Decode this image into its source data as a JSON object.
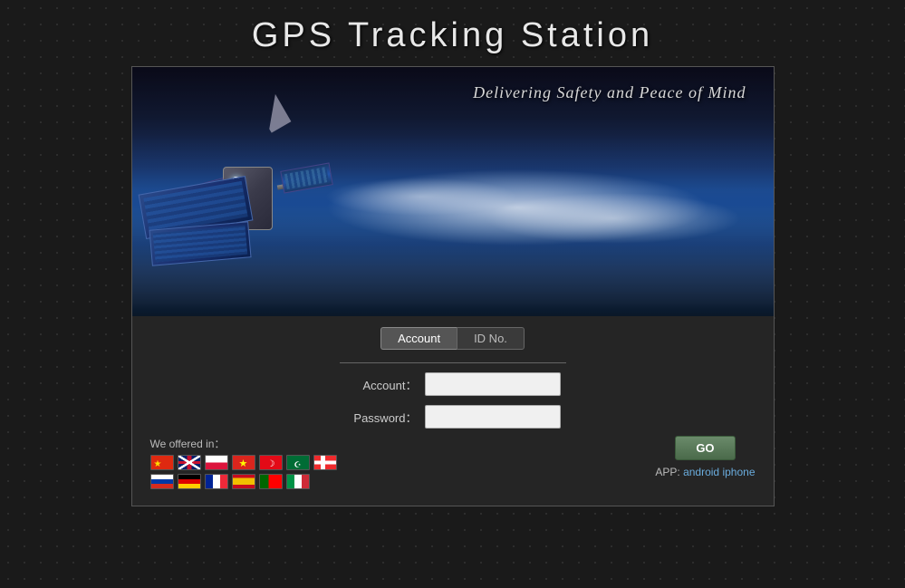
{
  "page": {
    "title": "GPS Tracking Station",
    "tagline": "Delivering Safety and Peace of Mind"
  },
  "tabs": [
    {
      "id": "account",
      "label": "Account",
      "active": true
    },
    {
      "id": "idno",
      "label": "ID No.",
      "active": false
    }
  ],
  "form": {
    "account_label": "Account：",
    "account_placeholder": "",
    "password_label": "Password：",
    "password_placeholder": ""
  },
  "buttons": {
    "go_label": "GO",
    "app_prefix": "APP:",
    "android_label": "android",
    "iphone_label": "iphone"
  },
  "languages": {
    "label": "We offered in：",
    "flags": [
      {
        "id": "cn",
        "name": "Chinese",
        "class": "flag-cn"
      },
      {
        "id": "gb",
        "name": "English",
        "class": "flag-gb"
      },
      {
        "id": "pl",
        "name": "Polish",
        "class": "flag-pl"
      },
      {
        "id": "vn",
        "name": "Vietnamese",
        "class": "flag-vn"
      },
      {
        "id": "tr",
        "name": "Turkish",
        "class": "flag-tr"
      },
      {
        "id": "sa",
        "name": "Arabic",
        "class": "flag-sa"
      },
      {
        "id": "no",
        "name": "Norwegian",
        "class": "flag-no"
      },
      {
        "id": "ru",
        "name": "Russian",
        "class": "flag-ru"
      },
      {
        "id": "de",
        "name": "German",
        "class": "flag-de"
      },
      {
        "id": "fr",
        "name": "French",
        "class": "flag-fr"
      },
      {
        "id": "es",
        "name": "Spanish",
        "class": "flag-es"
      },
      {
        "id": "pt",
        "name": "Portuguese",
        "class": "flag-pt"
      },
      {
        "id": "it",
        "name": "Italian",
        "class": "flag-it"
      }
    ]
  }
}
